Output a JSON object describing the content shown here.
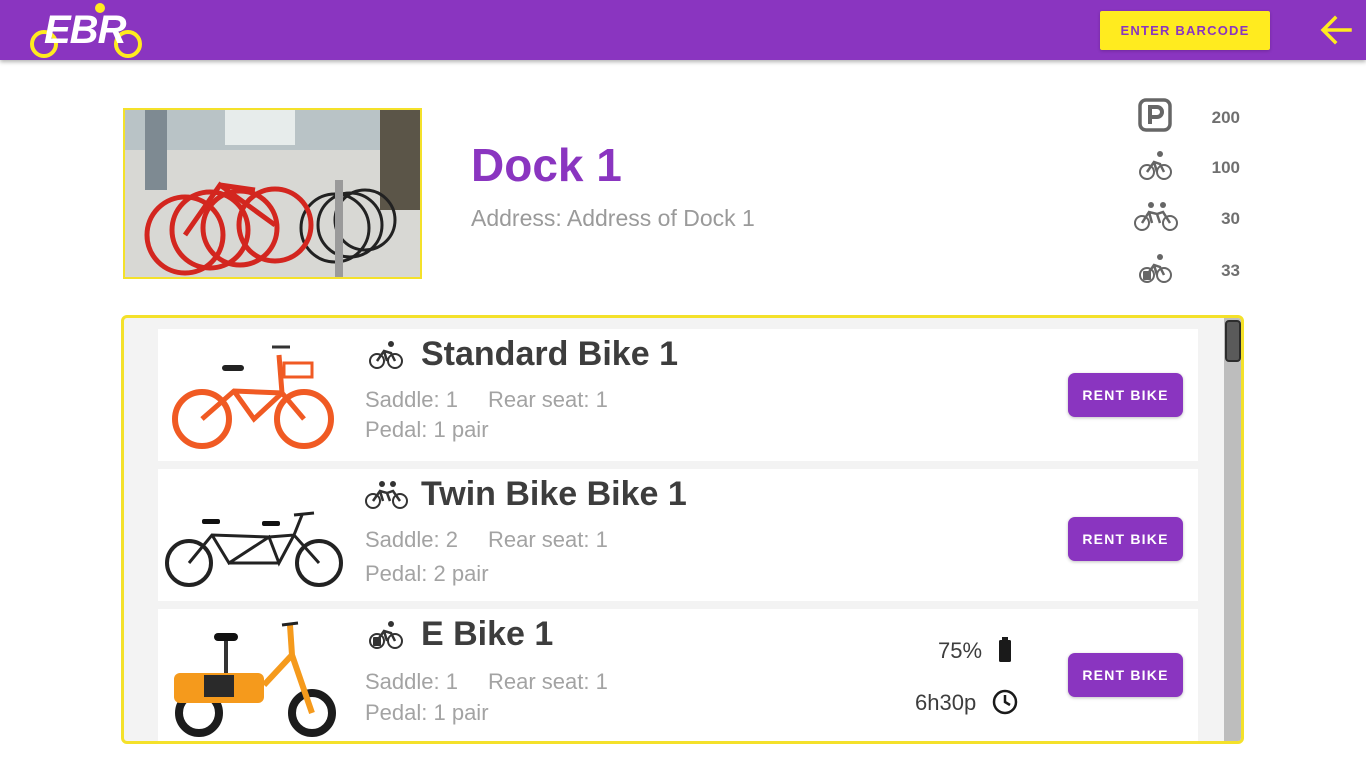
{
  "header": {
    "logo_text": "EBR",
    "barcode_label": "ENTER BARCODE",
    "back_icon": "arrow-left-icon",
    "colors": {
      "bar": "#8a35c0",
      "accent": "#ffeb1f"
    }
  },
  "dock": {
    "title": "Dock 1",
    "address": "Address: Address of Dock 1",
    "stats": [
      {
        "icon": "parking-icon",
        "value": "200"
      },
      {
        "icon": "standard-bike-icon",
        "value": "100"
      },
      {
        "icon": "twin-bike-icon",
        "value": "30"
      },
      {
        "icon": "e-bike-icon",
        "value": "33"
      }
    ]
  },
  "bikes": [
    {
      "name": "Standard Bike 1",
      "icon": "standard-bike-icon",
      "saddle": "Saddle: 1",
      "rear_seat": "Rear seat: 1",
      "pedal": "Pedal: 1 pair",
      "rent_label": "RENT BIKE"
    },
    {
      "name": "Twin Bike Bike 1",
      "icon": "twin-bike-icon",
      "saddle": "Saddle: 2",
      "rear_seat": "Rear seat: 1",
      "pedal": "Pedal: 2 pair",
      "rent_label": "RENT BIKE"
    },
    {
      "name": "E Bike 1",
      "icon": "e-bike-icon",
      "saddle": "Saddle: 1",
      "rear_seat": "Rear seat: 1",
      "pedal": "Pedal: 1 pair",
      "battery": "75%",
      "battery_icon": "battery-icon",
      "time_left": "6h30p",
      "time_icon": "clock-icon",
      "rent_label": "RENT BIKE"
    }
  ]
}
